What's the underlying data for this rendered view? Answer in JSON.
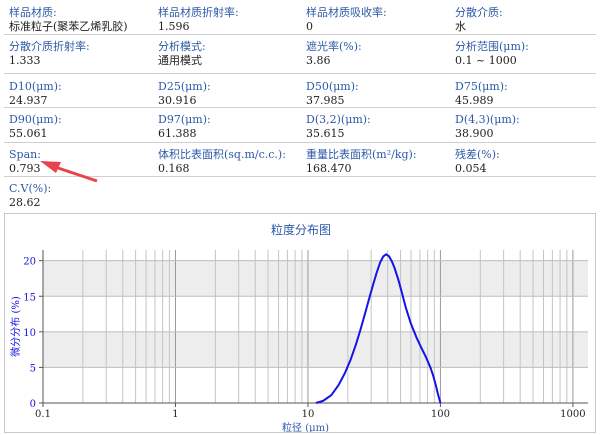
{
  "info_rows": [
    [
      {
        "label": "样品材质:",
        "value": "标准粒子(聚苯乙烯乳胶)"
      },
      {
        "label": "样品材质折射率:",
        "value": "1.596"
      },
      {
        "label": "样品材质吸收率:",
        "value": "0"
      },
      {
        "label": "分散介质:",
        "value": "水"
      }
    ],
    [
      {
        "label": "分散介质折射率:",
        "value": "1.333"
      },
      {
        "label": "分析模式:",
        "value": "通用模式"
      },
      {
        "label": "遮光率(%):",
        "value": "3.86"
      },
      {
        "label": "分析范围(μm):",
        "value": "0.1 ~ 1000"
      }
    ],
    [
      {
        "label": "D10(μm):",
        "value": "24.937"
      },
      {
        "label": "D25(μm):",
        "value": "30.916"
      },
      {
        "label": "D50(μm):",
        "value": "37.985"
      },
      {
        "label": "D75(μm):",
        "value": "45.989"
      }
    ],
    [
      {
        "label": "D90(μm):",
        "value": "55.061"
      },
      {
        "label": "D97(μm):",
        "value": "61.388"
      },
      {
        "label": "D(3,2)(μm):",
        "value": "35.615"
      },
      {
        "label": "D(4,3)(μm):",
        "value": "38.900"
      }
    ],
    [
      {
        "label": "Span:",
        "value": "0.793"
      },
      {
        "label": "体积比表面积(sq.m/c.c.):",
        "value": "0.168"
      },
      {
        "label": "重量比表面积(m²/kg):",
        "value": "168.470"
      },
      {
        "label": "残差(%):",
        "value": "0.054"
      }
    ],
    [
      {
        "label": "C.V(%):",
        "value": "28.62"
      }
    ]
  ],
  "colors": {
    "accent": "#2d5aa8",
    "curve": "#1414e6",
    "arrow": "#e8424a"
  },
  "chart_data": {
    "type": "line",
    "title": "粒度分布图",
    "xlabel": "粒径 (μm)",
    "ylabel": "微分分布 (%)",
    "xscale": "log",
    "xlim": [
      0.1,
      1300
    ],
    "ylim": [
      0,
      21.5
    ],
    "xticks": [
      0.1,
      1,
      10,
      100,
      1000
    ],
    "xtick_labels": [
      "0.1",
      "1",
      "10",
      "100",
      "1000"
    ],
    "yticks": [
      0,
      5,
      10,
      15,
      20
    ],
    "grid": true,
    "series": [
      {
        "x": [
          11.5,
          13,
          15,
          17,
          19,
          21,
          23,
          25,
          27,
          29,
          31,
          33,
          35,
          37,
          39,
          41,
          43,
          45,
          48,
          51,
          55,
          60,
          66,
          72,
          78,
          84,
          88,
          92,
          96,
          100
        ],
        "values": [
          0,
          0.3,
          1.1,
          2.5,
          4.2,
          6.1,
          8.2,
          10.4,
          12.6,
          14.7,
          16.6,
          18.3,
          19.7,
          20.6,
          20.9,
          20.6,
          19.9,
          19.0,
          17.4,
          15.6,
          13.3,
          11.1,
          9.2,
          7.7,
          6.4,
          5.0,
          3.9,
          2.6,
          1.2,
          0
        ]
      }
    ]
  }
}
